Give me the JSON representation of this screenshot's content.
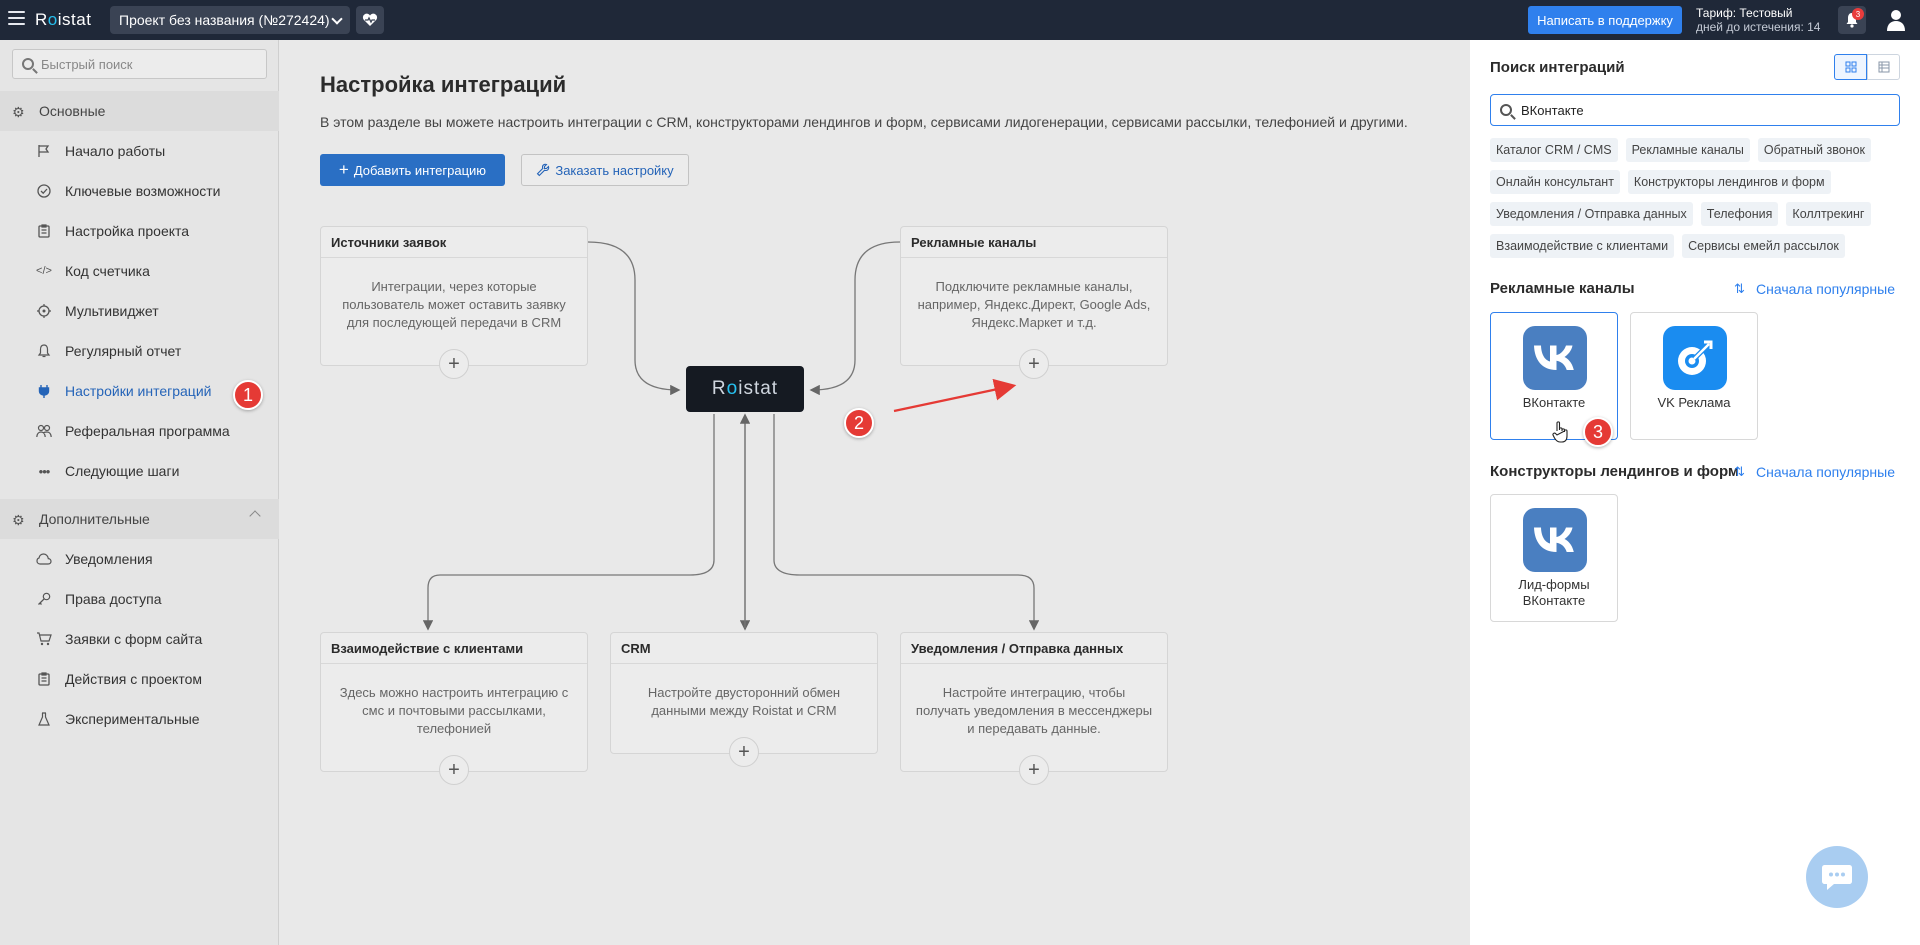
{
  "topbar": {
    "logo": "Roistat",
    "project": "Проект без названия (№272424)",
    "support_button": "Написать в поддержку",
    "tariff_line1": "Тариф: Тестовый",
    "tariff_line2": "дней до истечения: 14",
    "notifications_count": "3"
  },
  "sidebar": {
    "search_placeholder": "Быстрый поиск",
    "section_main": "Основные",
    "section_extra": "Дополнительные",
    "main_items": [
      {
        "label": "Начало работы",
        "icon": "flag-icon"
      },
      {
        "label": "Ключевые возможности",
        "icon": "check-circle-icon"
      },
      {
        "label": "Настройка проекта",
        "icon": "clipboard-icon"
      },
      {
        "label": "Код счетчика",
        "icon": "code-icon"
      },
      {
        "label": "Мультивиджет",
        "icon": "target-icon"
      },
      {
        "label": "Регулярный отчет",
        "icon": "bell-icon"
      },
      {
        "label": "Настройки интеграций",
        "icon": "plug-icon",
        "active": true
      },
      {
        "label": "Реферальная программа",
        "icon": "users-icon"
      },
      {
        "label": "Следующие шаги",
        "icon": "dots-icon"
      }
    ],
    "extra_items": [
      {
        "label": "Уведомления",
        "icon": "cloud-icon"
      },
      {
        "label": "Права доступа",
        "icon": "key-icon"
      },
      {
        "label": "Заявки с форм сайта",
        "icon": "cart-icon"
      },
      {
        "label": "Действия с проектом",
        "icon": "clipboard-icon"
      },
      {
        "label": "Экспериментальные",
        "icon": "flask-icon"
      }
    ]
  },
  "main": {
    "title": "Настройка интеграций",
    "description": "В этом разделе вы можете настроить интеграции с CRM, конструкторами лендингов и форм, сервисами лидогенерации, сервисами рассылки, телефонией и другими.",
    "add_button": "Добавить интеграцию",
    "order_button": "Заказать настройку",
    "hub_label": "Roistat",
    "cards": {
      "sources": {
        "title": "Источники заявок",
        "desc": "Интеграции, через которые пользователь может оставить заявку для последующей передачи в CRM"
      },
      "ads": {
        "title": "Рекламные каналы",
        "desc": "Подключите рекламные каналы, например, Яндекс.Директ, Google Ads, Яндекс.Маркет и т.д."
      },
      "clients": {
        "title": "Взаимодействие с клиентами",
        "desc": "Здесь можно настроить интеграцию с смс и почтовыми рассылками, телефонией"
      },
      "crm": {
        "title": "CRM",
        "desc": "Настройте двусторонний обмен данными между Roistat и CRM"
      },
      "notify": {
        "title": "Уведомления / Отправка данных",
        "desc": "Настройте интеграцию, чтобы получать уведомления в мессенджеры и передавать данные."
      }
    }
  },
  "markers": [
    "1",
    "2",
    "3"
  ],
  "panel": {
    "title": "Поиск интеграций",
    "search_value": "ВКонтакте",
    "tags": [
      "Каталог CRM / CMS",
      "Рекламные каналы",
      "Обратный звонок",
      "Онлайн консультант",
      "Конструкторы лендингов и форм",
      "Уведомления / Отправка данных",
      "Телефония",
      "Коллтрекинг",
      "Взаимодействие с клиентами",
      "Сервисы емейл рассылок"
    ],
    "section_ads": "Рекламные каналы",
    "section_builders": "Конструкторы лендингов и форм",
    "sort_label": "Сначала популярные",
    "ads_items": [
      {
        "label": "ВКонтакте",
        "icon": "vk-logo-icon"
      },
      {
        "label": "VK Реклама",
        "icon": "vk-ads-logo-icon"
      }
    ],
    "builder_items": [
      {
        "label": "Лид-формы ВКонтакте",
        "icon": "vk-logo-icon"
      }
    ]
  },
  "colors": {
    "topbar": "#1f2838",
    "accent": "#2f80ed",
    "marker": "#e53a35",
    "vk": "#4a7fc1"
  }
}
